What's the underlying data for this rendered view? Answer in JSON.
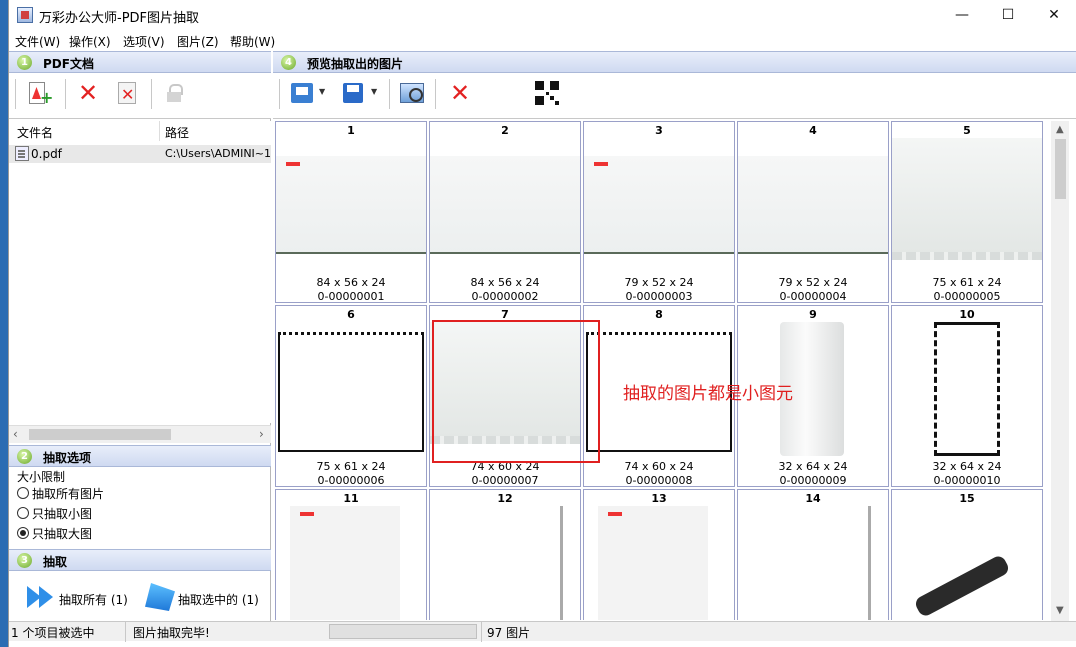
{
  "window": {
    "title": "万彩办公大师-PDF图片抽取",
    "min_glyph": "—",
    "max_glyph": "☐",
    "close_glyph": "✕"
  },
  "menu": [
    "文件(W)",
    "操作(X)",
    "选项(V)",
    "图片(Z)",
    "帮助(W)"
  ],
  "left": {
    "section1": {
      "num": "1",
      "title": "PDF文档"
    },
    "toolbar_icons": [
      "add-pdf-icon",
      "remove-icon",
      "remove-doc-icon",
      "lock-icon"
    ],
    "list_headers": {
      "name": "文件名",
      "path": "路径"
    },
    "files": [
      {
        "name": "0.pdf",
        "path": "C:\\Users\\ADMINI~1\\"
      }
    ],
    "hscroll": {
      "left": "‹",
      "right": "›"
    },
    "section2": {
      "num": "2",
      "title": "抽取选项"
    },
    "size_limit_label": "大小限制",
    "radios": [
      {
        "label": "抽取所有图片",
        "checked": false
      },
      {
        "label": "只抽取小图",
        "checked": false
      },
      {
        "label": "只抽取大图",
        "checked": true
      }
    ],
    "section3": {
      "num": "3",
      "title": "抽取"
    },
    "extract_all": "抽取所有 (1)",
    "extract_selected": "抽取选中的 (1)"
  },
  "right": {
    "section4": {
      "num": "4",
      "title": "预览抽取出的图片"
    },
    "toolbar_icons": [
      "print-icon",
      "save-icon",
      "preview-icon",
      "delete-icon",
      "qr-code-icon"
    ],
    "images": [
      {
        "num": "1",
        "dims": "84 x 56 x 24",
        "name": "0-00000001",
        "thumb": "flat"
      },
      {
        "num": "2",
        "dims": "84 x 56 x 24",
        "name": "0-00000002",
        "thumb": "flat-plain"
      },
      {
        "num": "3",
        "dims": "79 x 52 x 24",
        "name": "0-00000003",
        "thumb": "flat"
      },
      {
        "num": "4",
        "dims": "79 x 52 x 24",
        "name": "0-00000004",
        "thumb": "flat-plain"
      },
      {
        "num": "5",
        "dims": "75 x 61 x 24",
        "name": "0-00000005",
        "thumb": "board"
      },
      {
        "num": "6",
        "dims": "75 x 61 x 24",
        "name": "0-00000006",
        "thumb": "frame"
      },
      {
        "num": "7",
        "dims": "74 x 60 x 24",
        "name": "0-00000007",
        "thumb": "board"
      },
      {
        "num": "8",
        "dims": "74 x 60 x 24",
        "name": "0-00000008",
        "thumb": "frame"
      },
      {
        "num": "9",
        "dims": "32 x 64 x 24",
        "name": "0-00000009",
        "thumb": "tall"
      },
      {
        "num": "10",
        "dims": "32 x 64 x 24",
        "name": "0-00000010",
        "thumb": "tallframe"
      },
      {
        "num": "11",
        "dims": "",
        "name": "",
        "thumb": "page"
      },
      {
        "num": "12",
        "dims": "",
        "name": "",
        "thumb": "line"
      },
      {
        "num": "13",
        "dims": "",
        "name": "",
        "thumb": "page"
      },
      {
        "num": "14",
        "dims": "",
        "name": "",
        "thumb": "line"
      },
      {
        "num": "15",
        "dims": "",
        "name": "",
        "thumb": "cable"
      }
    ],
    "annotation": "抽取的图片都是小图元",
    "vscroll": {
      "up": "▲",
      "down": "▼"
    }
  },
  "status": {
    "selected": "1 个项目被选中",
    "message": "图片抽取完毕!",
    "count": "97 图片"
  },
  "colors": {
    "annotation": "#e02020",
    "section_header": "#cfdaf1",
    "accent_green": "#6aa82a"
  }
}
